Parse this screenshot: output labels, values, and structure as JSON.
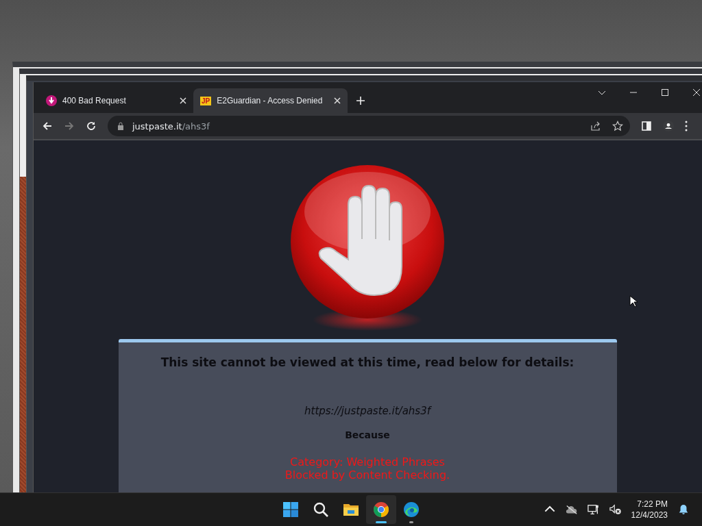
{
  "browser": {
    "tabs": [
      {
        "title": "400 Bad Request",
        "kind": "download",
        "selected": false
      },
      {
        "title": "E2Guardian - Access Denied",
        "kind": "badge",
        "favicon_text": "JP",
        "selected": true
      }
    ],
    "address": {
      "domain": "justpaste.it",
      "path": "/ahs3f"
    }
  },
  "page": {
    "heading": "This site cannot be viewed at this time, read below for details:",
    "url": "https://justpaste.it/ahs3f",
    "because": "Because",
    "reasons": [
      "Category: Weighted Phrases",
      "Blocked by Content Checking."
    ]
  },
  "taskbar": {
    "apps": [
      {
        "kind": "start",
        "selected": false,
        "running": false
      },
      {
        "kind": "search",
        "selected": false,
        "running": false
      },
      {
        "kind": "files",
        "selected": false,
        "running": false
      },
      {
        "kind": "chrome",
        "selected": true,
        "running": true
      },
      {
        "kind": "edge",
        "selected": false,
        "running": true
      }
    ],
    "clock": {
      "time": "7:22 PM",
      "date": "12/4/2023"
    }
  }
}
